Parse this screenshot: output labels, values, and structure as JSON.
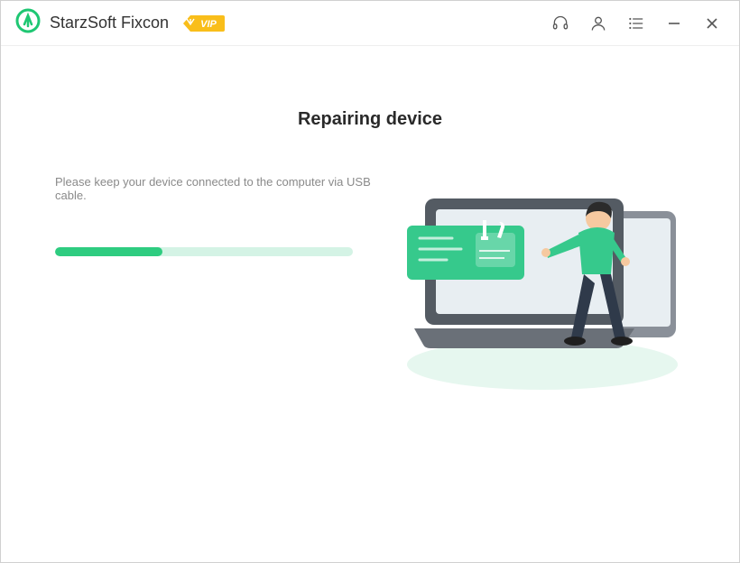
{
  "titlebar": {
    "app_name": "StarzSoft Fixcon",
    "vip_label": "VIP"
  },
  "main": {
    "heading": "Repairing device",
    "instruction": "Please keep your device connected to the computer via USB cable.",
    "progress_percent": 36
  },
  "colors": {
    "accent": "#2ecc80",
    "vip_bg": "#f9be1a",
    "vip_text": "#ffffff"
  }
}
